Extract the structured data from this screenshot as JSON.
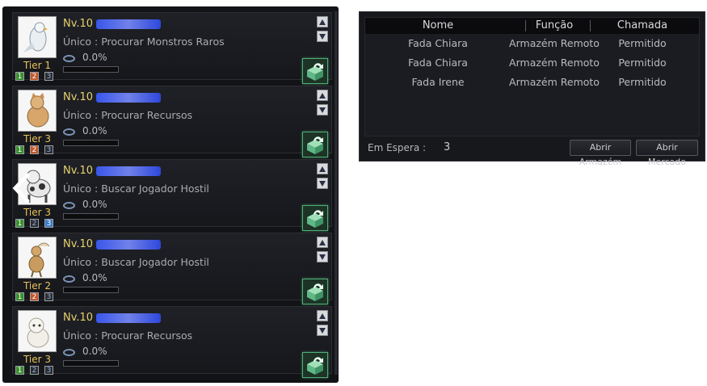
{
  "pets": [
    {
      "level": "Nv.10",
      "task": "Único : Procurar Monstros Raros",
      "tier": "Tier 1",
      "progress": "0.0%",
      "fill": 0,
      "slot_labels": [
        "1",
        "2",
        "3"
      ],
      "slot_colors": [
        "green",
        "orange",
        "dim"
      ],
      "portrait": "white-eagle"
    },
    {
      "level": "Nv.10",
      "task": "Único : Procurar Recursos",
      "tier": "Tier 3",
      "progress": "0.0%",
      "fill": 0,
      "slot_labels": [
        "1",
        "2",
        "3"
      ],
      "slot_colors": [
        "green",
        "orange",
        "dim"
      ],
      "portrait": "orange-cat"
    },
    {
      "level": "Nv.10",
      "task": "Único : Buscar Jogador Hostil",
      "tier": "Tier 3",
      "progress": "0.0%",
      "fill": 0,
      "slot_labels": [
        "1",
        "2",
        "3"
      ],
      "slot_colors": [
        "green",
        "dim",
        "blue"
      ],
      "portrait": "spotted-dog"
    },
    {
      "level": "Nv.10",
      "task": "Único : Buscar Jogador Hostil",
      "tier": "Tier 2",
      "progress": "0.0%",
      "fill": 0,
      "slot_labels": [
        "1",
        "2",
        "3"
      ],
      "slot_colors": [
        "green",
        "orange",
        "dim"
      ],
      "portrait": "fawn"
    },
    {
      "level": "Nv.10",
      "task": "Único : Procurar Recursos",
      "tier": "Tier 3",
      "progress": "0.0%",
      "fill": 0,
      "slot_labels": [
        "1",
        "2",
        "3"
      ],
      "slot_colors": [
        "green",
        "dim",
        "dim"
      ],
      "portrait": "white-puppy"
    }
  ],
  "table": {
    "headers": [
      "Nome",
      "Função",
      "Chamada"
    ],
    "rows": [
      [
        "Fada Chiara",
        "Armazém Remoto",
        "Permitido"
      ],
      [
        "Fada Chiara",
        "Armazém Remoto",
        "Permitido"
      ],
      [
        "Fada Irene",
        "Armazém Remoto",
        "Permitido"
      ]
    ]
  },
  "footer": {
    "waiting_label": "Em Espera :",
    "waiting_count": "3",
    "open_storage": "Abrir Armazém",
    "open_market": "Abrir Mercado"
  },
  "icons": {
    "scroll_up": "arrow-up-icon",
    "scroll_down": "arrow-down-icon",
    "action": "exchange-box-icon",
    "feed": "food-bowl-icon",
    "nav": "chevron-left-icon"
  },
  "colors": {
    "level": "#e7d26b",
    "tier": "#e8c25a",
    "action_border": "#4fae77",
    "name_redaction": "#3b5cff"
  }
}
